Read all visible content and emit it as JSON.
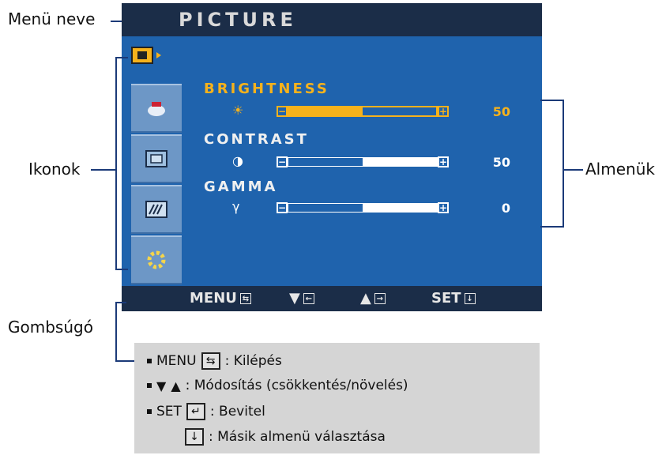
{
  "osd": {
    "menu_title": "PICTURE",
    "submenus": [
      {
        "label": "BRIGHTNESS",
        "symbol": "☀",
        "value": "50",
        "level": 0.5,
        "active": true
      },
      {
        "label": "CONTRAST",
        "symbol": "◑",
        "value": "50",
        "level": 0.5,
        "active": false
      },
      {
        "label": "GAMMA",
        "symbol": "γ",
        "value": "0",
        "level": 0.5,
        "active": false
      }
    ],
    "footer": {
      "menu_label": "MENU",
      "menu_icon": "⇆",
      "down_arrow": "▼",
      "down_icon": "←",
      "up_arrow": "▲",
      "up_icon": "→",
      "set_label": "SET",
      "set_icon": "↓"
    }
  },
  "callouts": {
    "menu_name": "Menü neve",
    "icons": "Ikonok",
    "submenus": "Almenük",
    "button_help": "Gombsúgó"
  },
  "help": {
    "rows": [
      {
        "key": "MENU",
        "icon": "⇆",
        "desc": ": Kilépés"
      },
      {
        "key_down": "▼",
        "key_up": "▲",
        "desc": ": Módosítás (csökkentés/növelés)"
      },
      {
        "key": "SET",
        "icon": "↵",
        "desc": ": Bevitel"
      },
      {
        "icon": "↓",
        "desc": ": Másik almenü választása"
      }
    ]
  },
  "colors": {
    "osd_blue": "#1f63ad",
    "osd_dark": "#1b2d48",
    "highlight": "#f6b21c",
    "help_bg": "#d5d5d5"
  }
}
